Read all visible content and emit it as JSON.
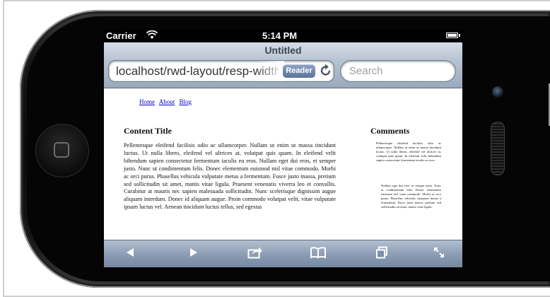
{
  "status_bar": {
    "carrier": "Carrier",
    "time": "5:14 PM"
  },
  "browser": {
    "page_title": "Untitled",
    "url": "localhost/rwd-layout/resp-width-",
    "reader_label": "Reader",
    "search_placeholder": "Search"
  },
  "page": {
    "nav_links": [
      "Home",
      "About",
      "Blog"
    ],
    "content_title": "Content Title",
    "content_text": "Pellentesque eleifend facilisis odio ac ullamcorper. Nullam ut enim ut massa tincidunt luctus. Ut nulla libero, eleifend vel ultrices at, volutpat quis quam. In eleifend velit bibendum sapien consectetur fermentum iaculis eu eros. Nullam eget dui eros, et semper justo. Nunc ut condimentum felis. Donec elementum euismod nisl vitae commodo. Morbi ac orci purus. Phasellus vehicula vulputate metus a fermentum. Fusce justo massa, pretium sed sollicitudin sit amet, mattis vitae ligula. Praesent venenatis viverra leo et convallis. Curabitur at mauris nec sapien malesuada sollicitudin. Nunc scelerisque dignissim augue aliquam interdum. Donec id aliquam augue. Proin commodo volutpat velit, vitae vulputate ipsum luctus vel. Aenean tincidunt luctus tellus, sed egestas",
    "comments_title": "Comments",
    "comment_1": "Pellentesque eleifend facilisis odio ac ullamcorper. Nullam ut enim ut massa tincidunt luctus. Ut nulla libero, eleifend vel ultrices at, volutpat quis quam. In eleifend velit bibendum sapien consectetur fermentum iaculis eu eros.",
    "comment_2": "Nullam eget dui eros, et semper justo. Nunc ut condimentum felis. Donec elementum euismod nisl vitae commodo. Morbi ac orci purus. Phasellus vehicula vulputate metus a fermentum. Fusce justo massa, pretium sed sollicitudin sit amet, mattis vitae ligula."
  },
  "toolbar": {
    "icons": [
      "back-icon",
      "forward-icon",
      "share-icon",
      "bookmarks-icon",
      "pages-icon",
      "fullscreen-icon"
    ]
  }
}
